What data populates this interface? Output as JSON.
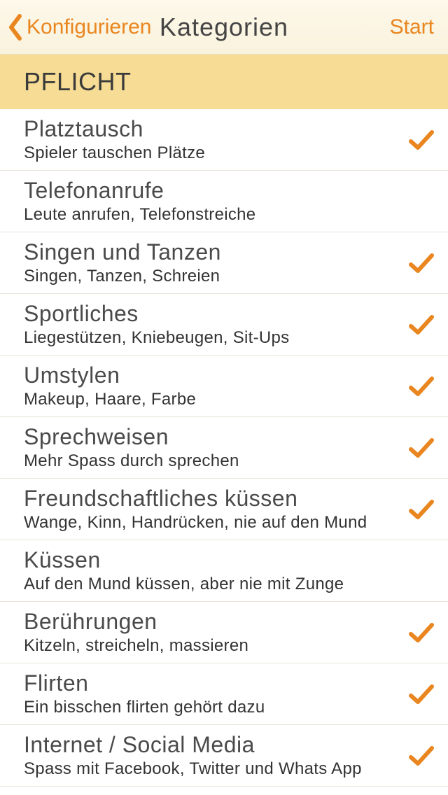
{
  "nav": {
    "back_label": "Konfigurieren",
    "title": "Kategorien",
    "right_label": "Start"
  },
  "section": {
    "title": "PFLICHT"
  },
  "categories": [
    {
      "title": "Platztausch",
      "subtitle": "Spieler tauschen Plätze",
      "checked": true
    },
    {
      "title": "Telefonanrufe",
      "subtitle": "Leute anrufen, Telefonstreiche",
      "checked": false
    },
    {
      "title": "Singen und Tanzen",
      "subtitle": "Singen, Tanzen, Schreien",
      "checked": true
    },
    {
      "title": "Sportliches",
      "subtitle": "Liegestützen, Kniebeugen, Sit-Ups",
      "checked": true
    },
    {
      "title": "Umstylen",
      "subtitle": "Makeup, Haare, Farbe",
      "checked": true
    },
    {
      "title": "Sprechweisen",
      "subtitle": "Mehr Spass durch sprechen",
      "checked": true
    },
    {
      "title": "Freundschaftliches küssen",
      "subtitle": "Wange, Kinn, Handrücken, nie auf den Mund",
      "checked": true
    },
    {
      "title": "Küssen",
      "subtitle": "Auf den Mund küssen, aber nie mit Zunge",
      "checked": false
    },
    {
      "title": "Berührungen",
      "subtitle": "Kitzeln, streicheln, massieren",
      "checked": true
    },
    {
      "title": "Flirten",
      "subtitle": "Ein bisschen flirten gehört dazu",
      "checked": true
    },
    {
      "title": "Internet / Social Media",
      "subtitle": "Spass mit Facebook, Twitter und Whats App",
      "checked": true
    }
  ],
  "colors": {
    "accent": "#e98620"
  }
}
